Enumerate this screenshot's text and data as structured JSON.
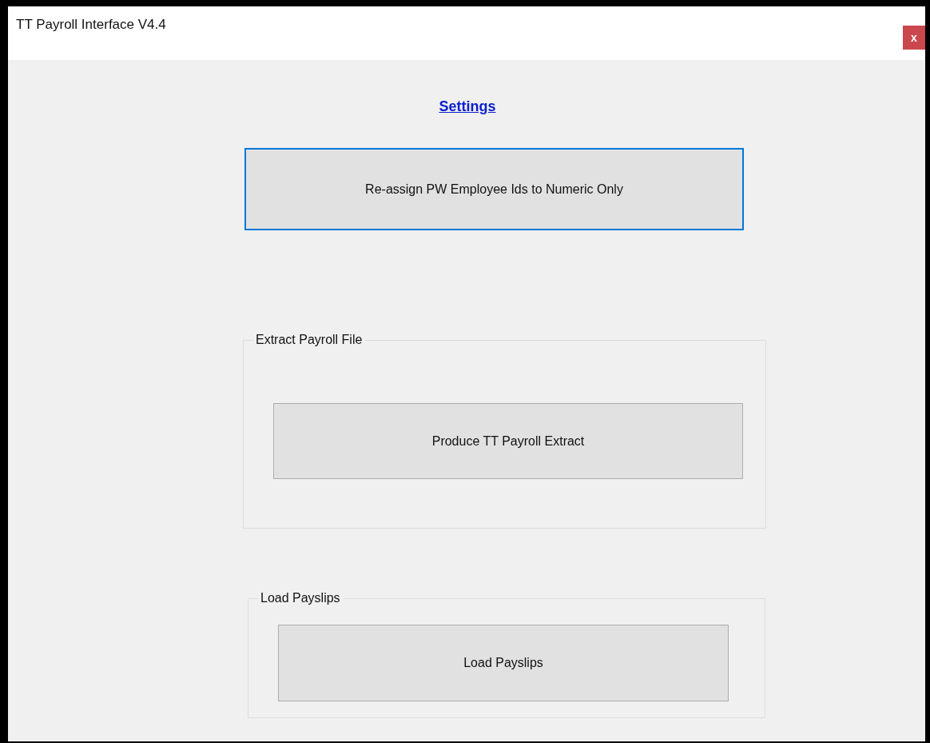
{
  "window": {
    "title": "TT Payroll Interface V4.4",
    "close": "x"
  },
  "settings_link": "Settings",
  "main_button": {
    "label": "Re-assign PW Employee Ids to Numeric Only",
    "focused": true
  },
  "groups": [
    {
      "title": "Extract Payroll File",
      "button": {
        "label": "Produce TT Payroll Extract",
        "focused": false
      }
    },
    {
      "title": "Load Payslips",
      "button": {
        "label": "Load Payslips",
        "focused": false
      }
    }
  ]
}
